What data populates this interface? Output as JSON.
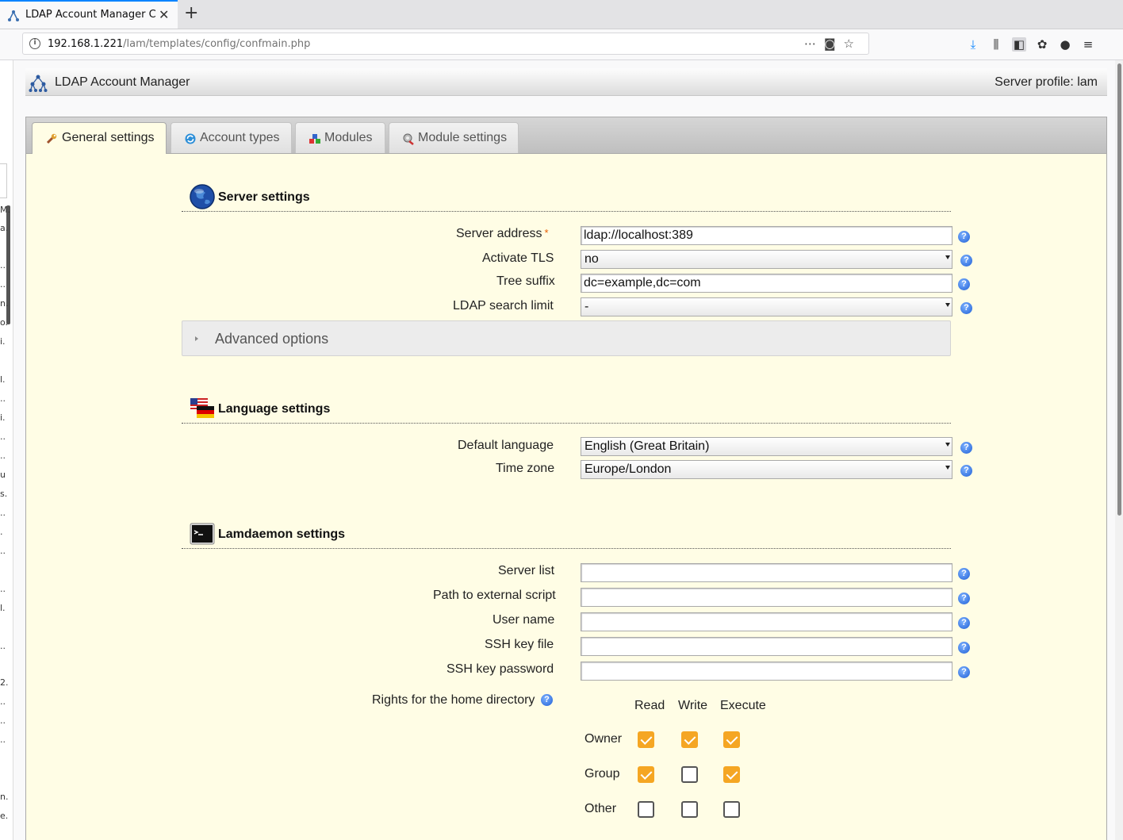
{
  "browser": {
    "tab_title": "LDAP Account Manager Configuration",
    "new_tab_symbol": "+",
    "close_symbol": "✕",
    "url_host": "192.168.1.221",
    "url_path": "/lam/templates/config/confmain.php"
  },
  "left_strip_chars": [
    "M.",
    "a.",
    "..",
    "..",
    "n.",
    "o.",
    "i.",
    "l.",
    "..",
    "i.",
    "..",
    "..",
    "u",
    "s.",
    "..",
    ".",
    "..",
    "..",
    "l.",
    "..",
    "2.",
    "..",
    "..",
    "..",
    "n.",
    "e."
  ],
  "header": {
    "app_title": "LDAP Account Manager",
    "profile": "Server profile: lam"
  },
  "tabs": [
    {
      "label": "General settings",
      "active": true
    },
    {
      "label": "Account types",
      "active": false
    },
    {
      "label": "Modules",
      "active": false
    },
    {
      "label": "Module settings",
      "active": false
    }
  ],
  "server": {
    "title": "Server settings",
    "address_label": "Server address",
    "required_mark": "*",
    "address_value": "ldap://localhost:389",
    "tls_label": "Activate TLS",
    "tls_value": "no",
    "suffix_label": "Tree suffix",
    "suffix_value": "dc=example,dc=com",
    "limit_label": "LDAP search limit",
    "limit_value": "-",
    "advanced_label": "Advanced options"
  },
  "language": {
    "title": "Language settings",
    "default_label": "Default language",
    "default_value": "English (Great Britain)",
    "timezone_label": "Time zone",
    "timezone_value": "Europe/London"
  },
  "lamdaemon": {
    "title": "Lamdaemon settings",
    "server_list_label": "Server list",
    "server_list_value": "",
    "script_label": "Path to external script",
    "script_value": "",
    "user_label": "User name",
    "user_value": "",
    "ssh_key_label": "SSH key file",
    "ssh_key_value": "",
    "ssh_pass_label": "SSH key password",
    "ssh_pass_value": "",
    "rights_label": "Rights for the home directory",
    "columns": [
      "Read",
      "Write",
      "Execute"
    ],
    "rows": [
      {
        "label": "Owner",
        "values": [
          true,
          true,
          true
        ]
      },
      {
        "label": "Group",
        "values": [
          true,
          false,
          true
        ]
      },
      {
        "label": "Other",
        "values": [
          false,
          false,
          false
        ]
      }
    ]
  },
  "help_symbol": "?",
  "colors": {
    "content_bg": "#fffde5",
    "checkbox_on": "#f5a623",
    "help_icon": "#1f5fd6",
    "tab_accent": "#0a84ff"
  }
}
